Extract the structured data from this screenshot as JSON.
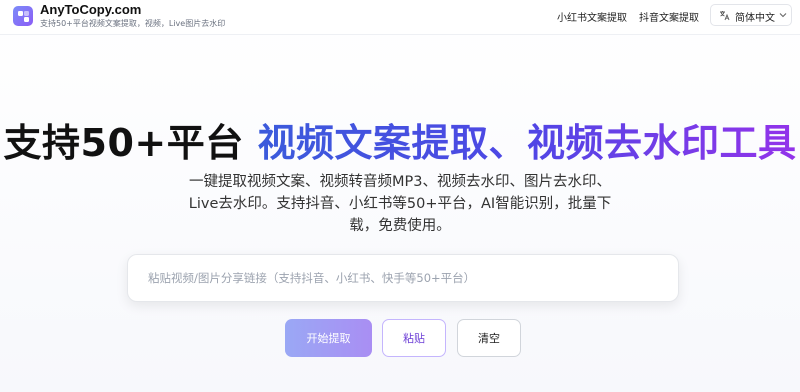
{
  "header": {
    "brand_name": "AnyToCopy.com",
    "brand_tagline": "支持50+平台视频文案提取，视频，Live图片去水印",
    "nav": {
      "xiaohongshu": "小红书文案提取",
      "douyin": "抖音文案提取"
    },
    "language": "简体中文"
  },
  "hero": {
    "title_plain": "支持50+平台",
    "title_highlight": "视频文案提取、视频去水印工具",
    "desc_line1": "一键提取视频文案、视频转音频MP3、视频去水印、图片去水印、",
    "desc_line2": "Live去水印。支持抖音、小红书等50+平台，AI智能识别，批量下",
    "desc_line3": "载，免费使用。"
  },
  "input": {
    "placeholder": "粘贴视频/图片分享链接（支持抖音、小红书、快手等50+平台）",
    "value": ""
  },
  "actions": {
    "start": "开始提取",
    "paste": "粘贴",
    "clear": "清空"
  },
  "colors": {
    "accent_blue": "#3b5bdb",
    "accent_purple": "#9333ea",
    "start_button": "#a3a3f4"
  }
}
